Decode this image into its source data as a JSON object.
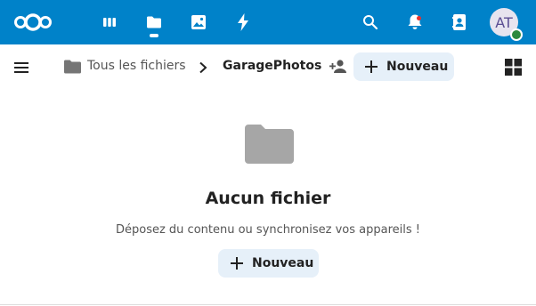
{
  "colors": {
    "header_bg": "#0082c9",
    "button_bg": "#e6f0f9",
    "avatar_bg": "#e7e4ef",
    "status_online": "#2d8a3e",
    "notification_dot": "#e9322d",
    "folder_gray": "#a6a6a6"
  },
  "header": {
    "logo_icon": "nextcloud-logo",
    "apps": [
      {
        "icon": "dashboard-icon"
      },
      {
        "icon": "files-icon",
        "active": true
      },
      {
        "icon": "photos-icon"
      },
      {
        "icon": "activity-icon"
      }
    ],
    "right_icons": [
      "search-icon",
      "notifications-icon",
      "contacts-icon"
    ],
    "avatar_initials": "AT"
  },
  "breadcrumb": {
    "root_label": "Tous les fichiers",
    "current_label": "GaragePhotos",
    "new_button_label": "Nouveau"
  },
  "empty_state": {
    "title": "Aucun fichier",
    "description": "Déposez du contenu ou synchronisez vos appareils !",
    "new_button_label": "Nouveau"
  }
}
